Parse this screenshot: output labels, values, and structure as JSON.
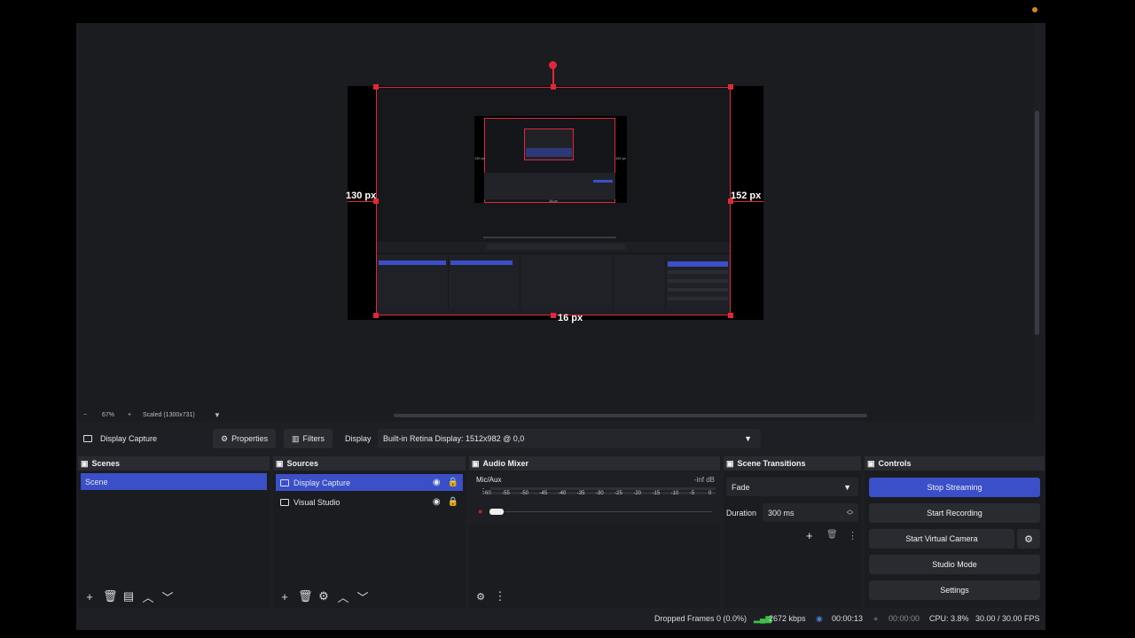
{
  "preview": {
    "left_offset": "130 px",
    "right_offset": "152 px",
    "bottom_offset": "16 px",
    "nested_left": "130 px",
    "nested_right": "152 px",
    "nested_bottom": "16 px"
  },
  "zoom": {
    "minus": "−",
    "level": "67%",
    "plus": "+",
    "scale_mode": "Scaled (1300x731)"
  },
  "context": {
    "source_name": "Display Capture",
    "properties_label": "Properties",
    "filters_label": "Filters",
    "display_label": "Display",
    "display_value": "Built-in Retina Display: 1512x982 @ 0,0"
  },
  "scenes": {
    "title": "Scenes",
    "items": [
      "Scene"
    ]
  },
  "sources": {
    "title": "Sources",
    "items": [
      "Display Capture",
      "Visual Studio"
    ]
  },
  "mixer": {
    "title": "Audio Mixer",
    "channel": "Mic/Aux",
    "level": "-inf dB",
    "ticks": [
      "-60",
      "-55",
      "-50",
      "-45",
      "-40",
      "-35",
      "-30",
      "-25",
      "-20",
      "-15",
      "-10",
      "-5",
      "0"
    ]
  },
  "transitions": {
    "title": "Scene Transitions",
    "selected": "Fade",
    "duration_label": "Duration",
    "duration_value": "300 ms"
  },
  "controls": {
    "title": "Controls",
    "stop_streaming": "Stop Streaming",
    "start_recording": "Start Recording",
    "start_virtual_camera": "Start Virtual Camera",
    "studio_mode": "Studio Mode",
    "settings": "Settings"
  },
  "status": {
    "dropped_frames": "Dropped Frames 0 (0.0%)",
    "bitrate": "2672 kbps",
    "stream_time": "00:00:13",
    "record_time": "00:00:00",
    "cpu": "CPU: 3.8%",
    "fps": "30.00 / 30.00 FPS"
  },
  "colors": {
    "accent": "#3a4fc8",
    "selection": "#e0283a",
    "bitrate_green": "#3fbf4a"
  }
}
